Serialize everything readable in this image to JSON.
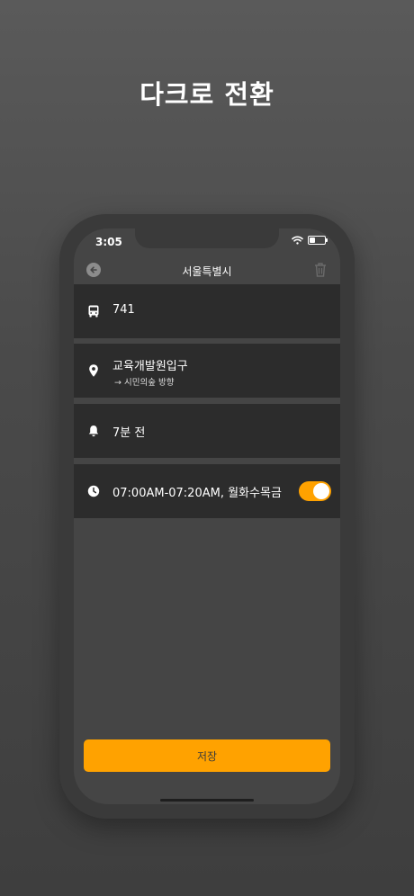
{
  "headline": "다크로 전환",
  "status": {
    "time": "3:05"
  },
  "nav": {
    "title": "서울특별시"
  },
  "rows": [
    {
      "icon": "bus-icon",
      "text": "741"
    },
    {
      "icon": "location-pin-icon",
      "text": "교육개발원입구",
      "sub": "→ 시민의숲 방향"
    },
    {
      "icon": "bell-icon",
      "text": "7분 전"
    },
    {
      "icon": "clock-icon",
      "text": "07:00AM-07:20AM, 월화수목금",
      "toggle_on": true
    }
  ],
  "save_label": "저장",
  "colors": {
    "accent": "#ffa200",
    "row_bg": "#2c2c2c",
    "screen_bg": "#454545"
  }
}
